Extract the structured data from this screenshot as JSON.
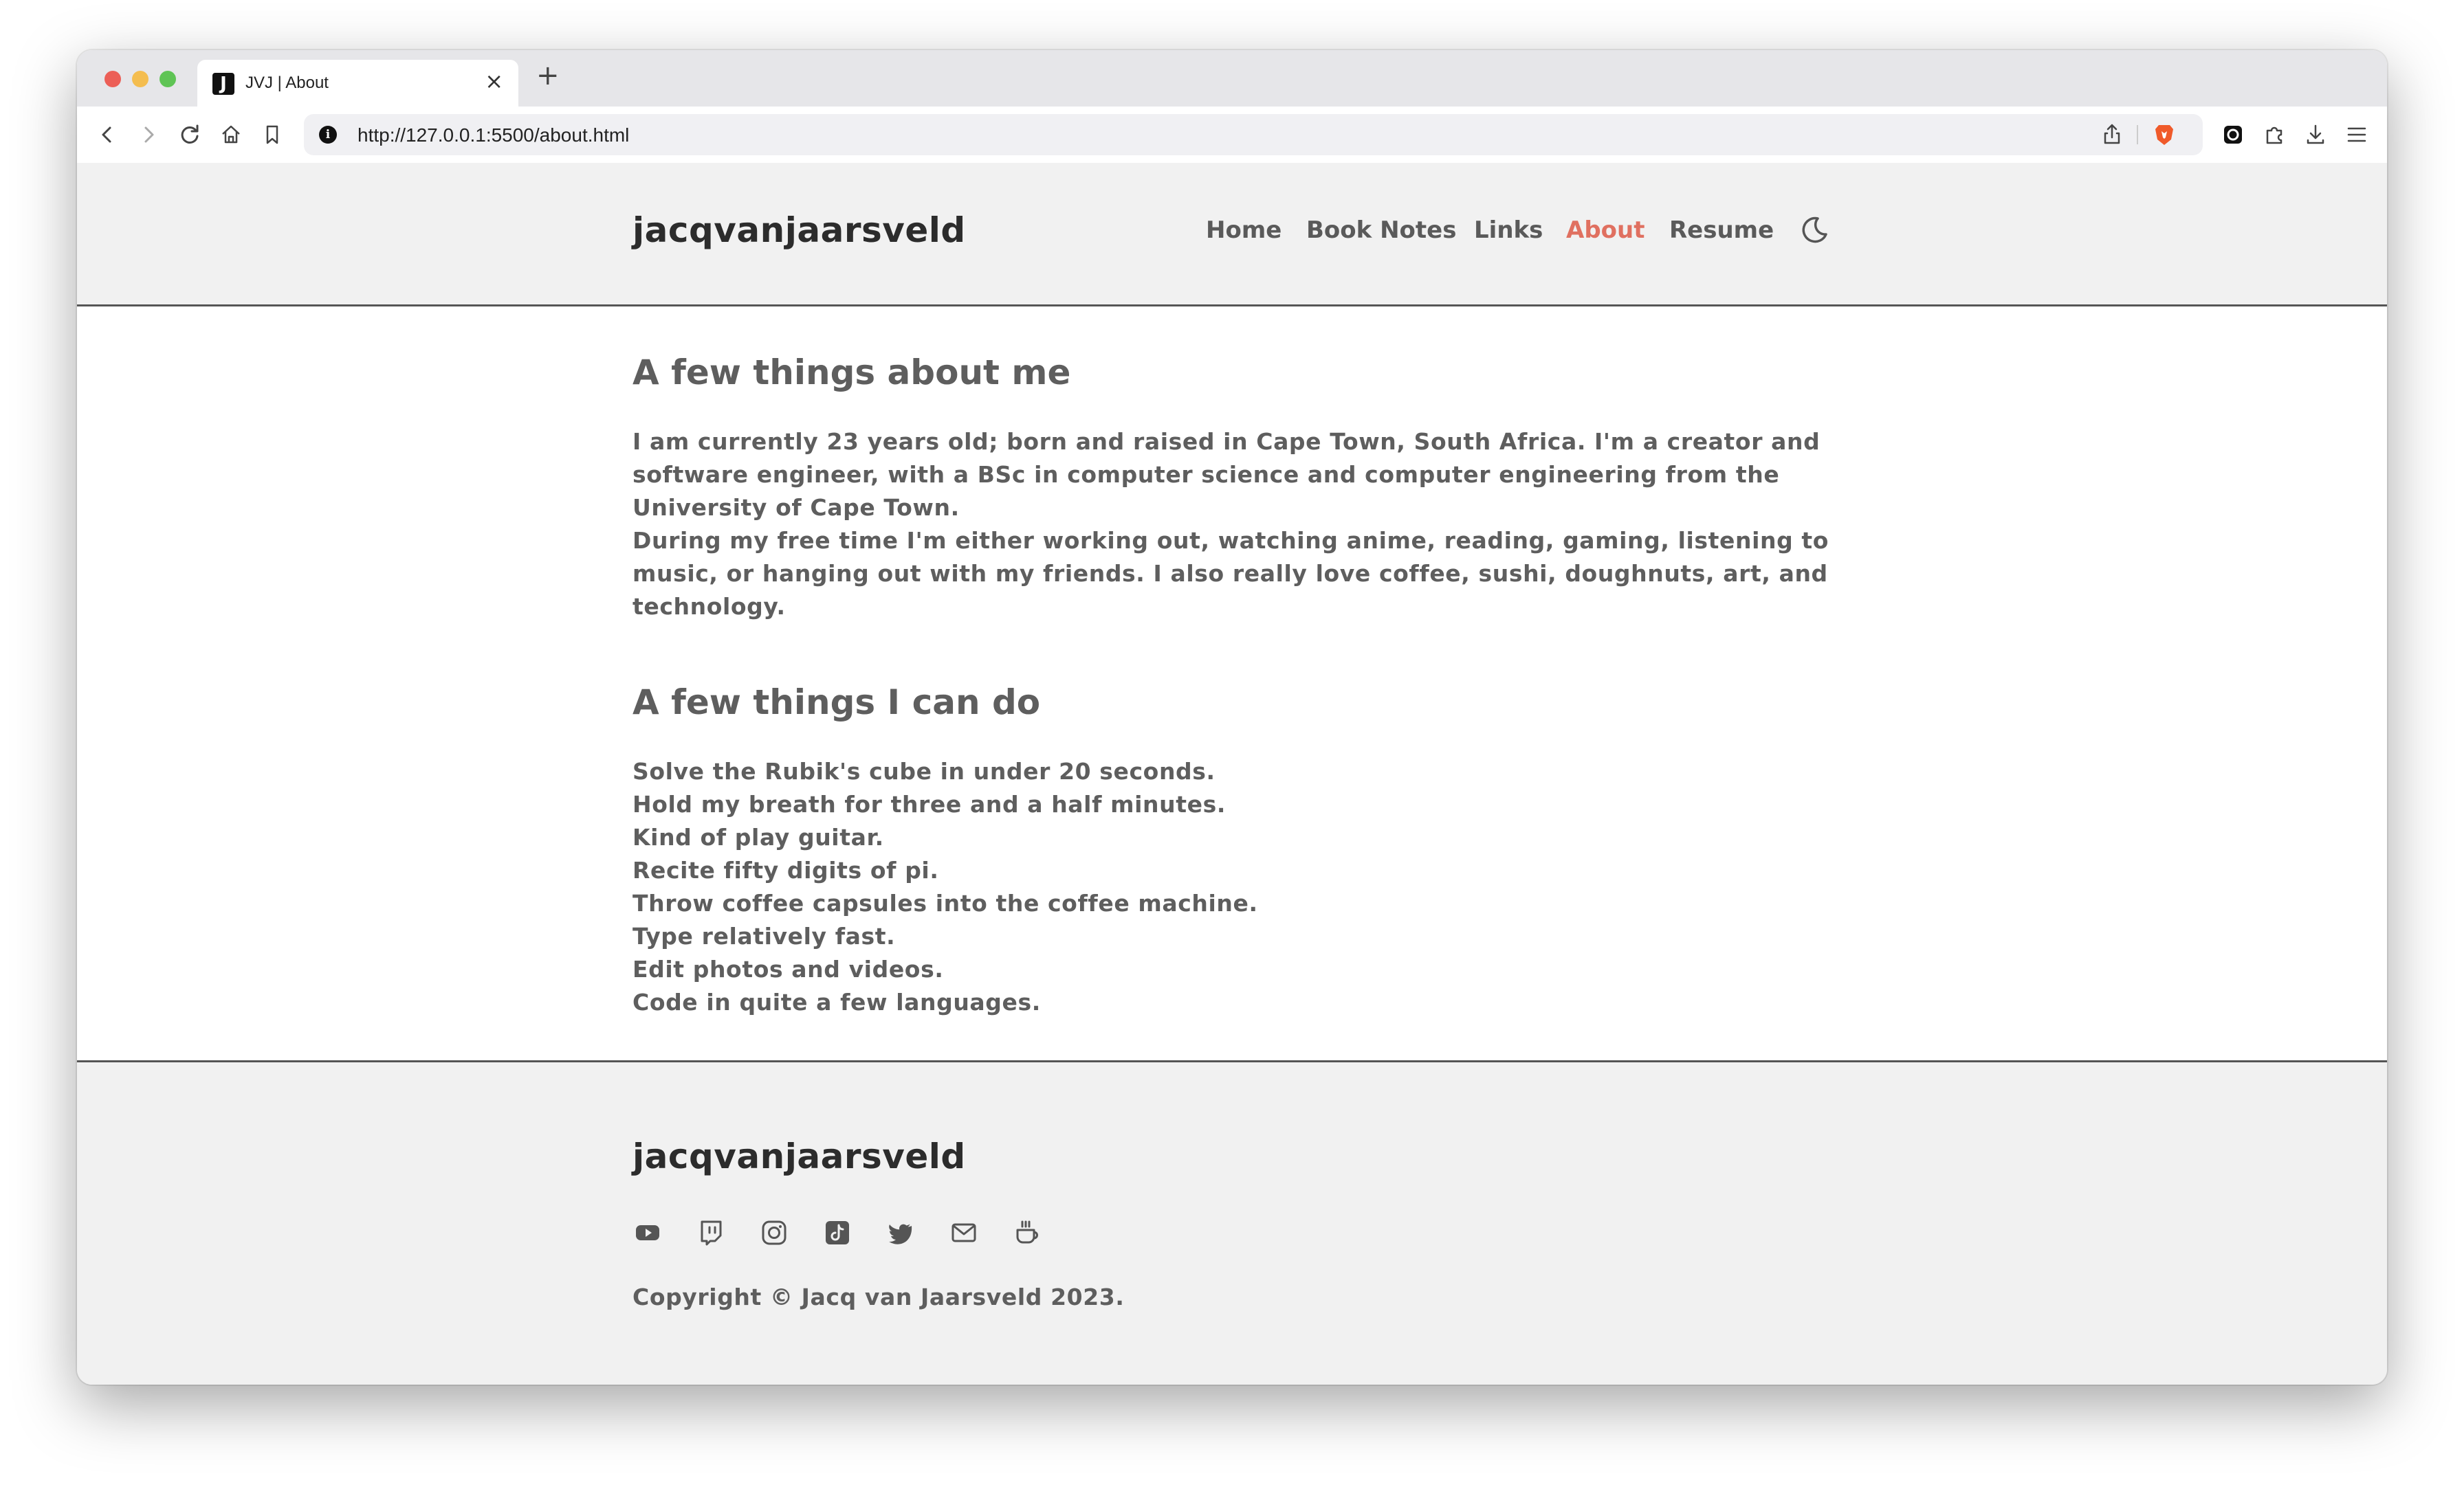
{
  "browser": {
    "tab_title": "JVJ | About",
    "tab_favicon_letter": "J",
    "tab_close": "×",
    "new_tab": "+",
    "url": "http://127.0.0.1:5500/about.html",
    "toolbar_icons": [
      "back-icon",
      "forward-icon",
      "reload-icon",
      "home-icon",
      "bookmark-icon",
      "site-info-icon",
      "share-icon",
      "brave-shield-icon",
      "extension-icon",
      "puzzle-icon",
      "download-icon",
      "menu-icon"
    ]
  },
  "header": {
    "brand": "jacqvanjaarsveld",
    "nav": [
      {
        "label": "Home",
        "active": false
      },
      {
        "label": "Book Notes",
        "active": false
      },
      {
        "label": "Links",
        "active": false
      },
      {
        "label": "About",
        "active": true
      },
      {
        "label": "Resume",
        "active": false
      }
    ],
    "theme_toggle_icon": "moon-icon",
    "accent_color": "#e07060"
  },
  "about": {
    "heading": "A few things about me",
    "lines": [
      "I am currently 23 years old; born and raised in Cape Town, South Africa. I'm a creator and",
      "software engineer, with a BSc in computer science and computer engineering from the",
      "University of Cape Town.",
      "During my free time I'm either working out, watching anime, reading, gaming, listening to",
      "music, or hanging out with my friends. I also really love coffee, sushi, doughnuts, art, and",
      "technology."
    ]
  },
  "skills": {
    "heading": "A few things I can do",
    "items": [
      "Solve the Rubik's cube in under 20 seconds.",
      "Hold my breath for three and a half minutes.",
      "Kind of play guitar.",
      "Recite fifty digits of pi.",
      "Throw coffee capsules into the coffee machine.",
      "Type relatively fast.",
      "Edit photos and videos.",
      "Code in quite a few languages."
    ]
  },
  "footer": {
    "brand": "jacqvanjaarsveld",
    "social_icons": [
      "youtube-icon",
      "twitch-icon",
      "instagram-icon",
      "tiktok-icon",
      "twitter-icon",
      "email-icon",
      "coffee-icon"
    ],
    "copyright": "Copyright © Jacq van Jaarsveld 2023."
  }
}
